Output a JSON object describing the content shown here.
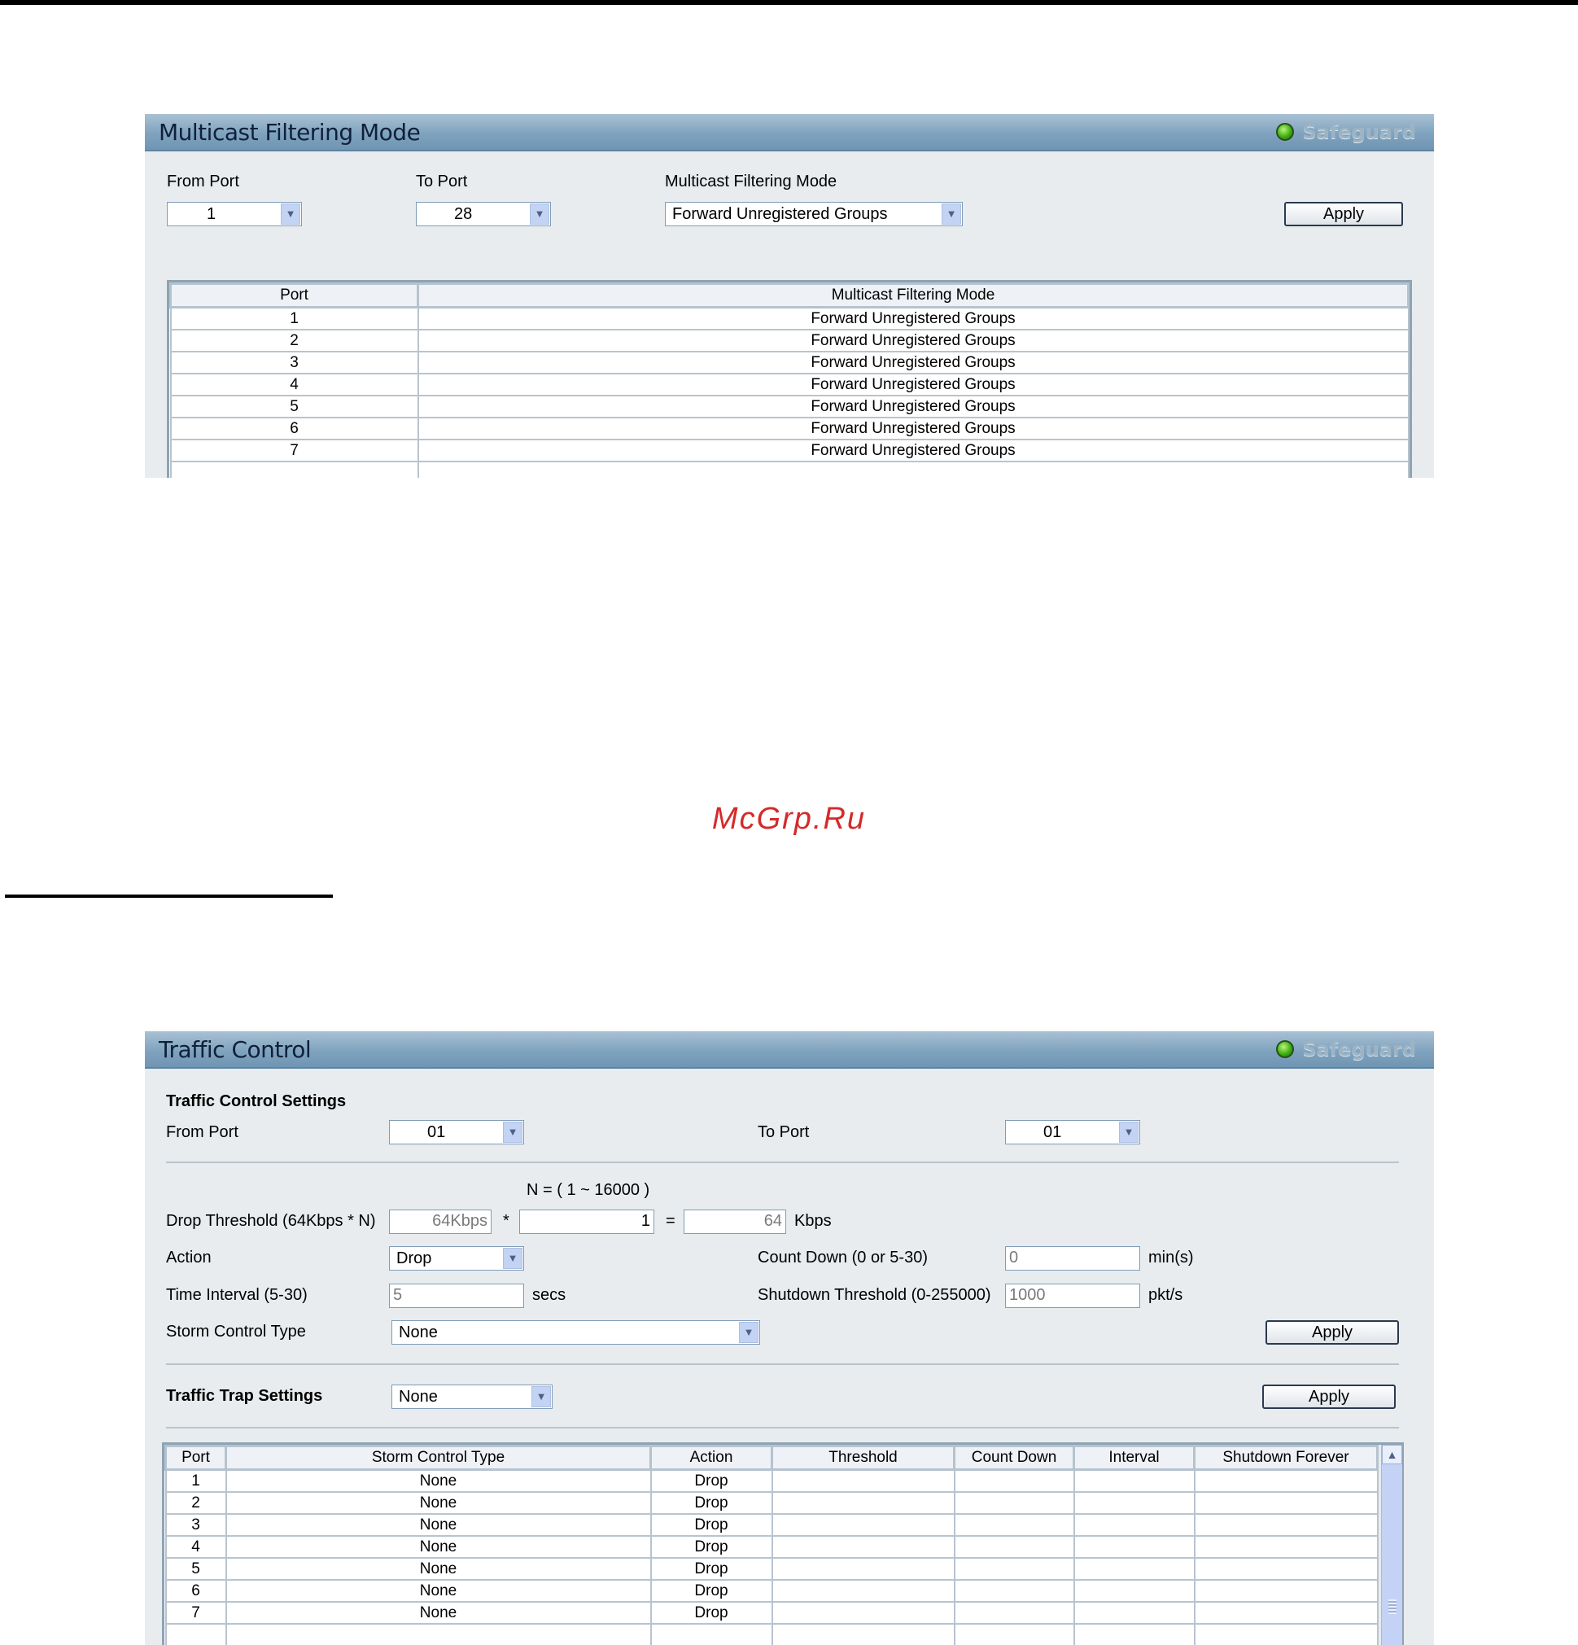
{
  "multicast_panel": {
    "title": "Multicast Filtering Mode",
    "safeguard": "Safeguard",
    "from_port_label": "From Port",
    "from_port_value": "1",
    "to_port_label": "To Port",
    "to_port_value": "28",
    "mode_label": "Multicast Filtering Mode",
    "mode_value": "Forward Unregistered Groups",
    "apply": "Apply",
    "table_headers": [
      "Port",
      "Multicast Filtering Mode"
    ],
    "rows": [
      {
        "port": "1",
        "mode": "Forward Unregistered Groups"
      },
      {
        "port": "2",
        "mode": "Forward Unregistered Groups"
      },
      {
        "port": "3",
        "mode": "Forward Unregistered Groups"
      },
      {
        "port": "4",
        "mode": "Forward Unregistered Groups"
      },
      {
        "port": "5",
        "mode": "Forward Unregistered Groups"
      },
      {
        "port": "6",
        "mode": "Forward Unregistered Groups"
      },
      {
        "port": "7",
        "mode": "Forward Unregistered Groups"
      }
    ]
  },
  "watermark": "McGrp.Ru",
  "traffic_panel": {
    "title": "Traffic Control",
    "safeguard": "Safeguard",
    "settings_heading": "Traffic Control Settings",
    "from_port_label": "From Port",
    "from_port_value": "01",
    "to_port_label": "To Port",
    "to_port_value": "01",
    "n_range": "N = ( 1 ~ 16000 )",
    "drop_threshold_label": "Drop Threshold (64Kbps * N)",
    "drop_base": "64Kbps",
    "times": "*",
    "n_value": "1",
    "equals": "=",
    "result_value": "64",
    "kbps": "Kbps",
    "action_label": "Action",
    "action_value": "Drop",
    "count_down_label": "Count Down (0 or 5-30)",
    "count_down_value": "0",
    "mins": "min(s)",
    "time_interval_label": "Time Interval (5-30)",
    "time_interval_value": "5",
    "secs": "secs",
    "shutdown_label": "Shutdown Threshold (0-255000)",
    "shutdown_value": "1000",
    "pkts": "pkt/s",
    "storm_label": "Storm Control Type",
    "storm_value": "None",
    "apply1": "Apply",
    "trap_label": "Traffic Trap Settings",
    "trap_value": "None",
    "apply2": "Apply",
    "table_headers": [
      "Port",
      "Storm Control Type",
      "Action",
      "Threshold",
      "Count Down",
      "Interval",
      "Shutdown Forever"
    ],
    "rows": [
      {
        "port": "1",
        "type": "None",
        "action": "Drop"
      },
      {
        "port": "2",
        "type": "None",
        "action": "Drop"
      },
      {
        "port": "3",
        "type": "None",
        "action": "Drop"
      },
      {
        "port": "4",
        "type": "None",
        "action": "Drop"
      },
      {
        "port": "5",
        "type": "None",
        "action": "Drop"
      },
      {
        "port": "6",
        "type": "None",
        "action": "Drop"
      },
      {
        "port": "7",
        "type": "None",
        "action": "Drop"
      }
    ]
  }
}
